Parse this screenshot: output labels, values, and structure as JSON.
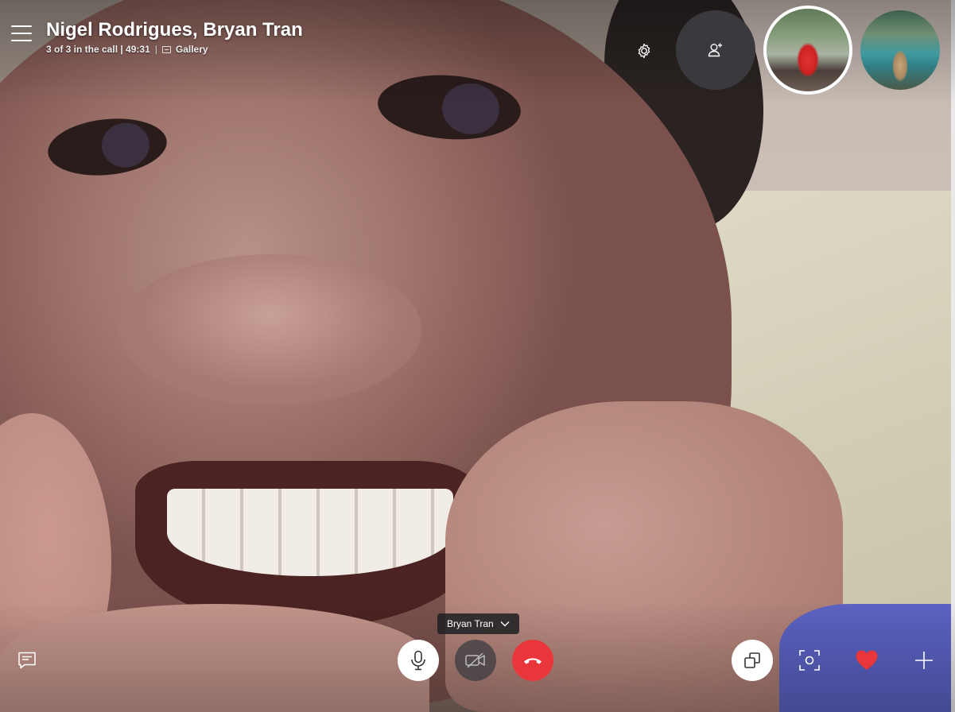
{
  "call": {
    "title": "Nigel Rodrigues, Bryan Tran",
    "participant_status": "3 of 3 in the call | 49:31",
    "separator": "|",
    "view_mode": "Gallery"
  },
  "header_controls": {
    "settings_icon": "gear-icon",
    "add_participant_icon": "add-person-icon"
  },
  "participants": [
    {
      "scene": "person in red jacket on suspension bridge",
      "active": true
    },
    {
      "scene": "person standing by turquoise river",
      "active": false
    }
  ],
  "bottom_bar": {
    "speaker_label": "Bryan Tran",
    "chat_icon": "chat-icon",
    "mic_icon": "microphone-icon",
    "video_icon": "video-off-icon",
    "hangup_icon": "end-call-icon",
    "switch_icon": "switch-camera-icon",
    "snapshot_icon": "snapshot-icon",
    "reaction_icon": "heart-icon",
    "more_icon": "plus-icon"
  },
  "colors": {
    "hangup": "#e8363a",
    "heart": "#e8363a",
    "add_button_bg": "#3a3a3e"
  }
}
